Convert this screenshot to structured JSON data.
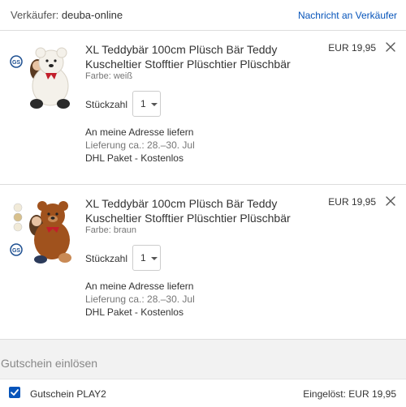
{
  "seller": {
    "label": "Verkäufer:",
    "name": "deuba-online",
    "contact_link": "Nachricht an Verkäufer"
  },
  "items": [
    {
      "title": "XL Teddybär 100cm Plüsch Bär Teddy Kuscheltier Stofftier Plüschtier Plüschbär",
      "variant": "Farbe: weiß",
      "price": "EUR 19,95",
      "qty_label": "Stückzahl",
      "qty_value": "1",
      "ship_method": "An meine Adresse liefern",
      "ship_date": "Lieferung ca.: 28.–30. Jul",
      "ship_carrier": "DHL Paket - Kostenlos",
      "image_icon": "white-teddy-bear-image",
      "bear_color": "#f4f1ea"
    },
    {
      "title": "XL Teddybär 100cm Plüsch Bär Teddy Kuscheltier Stofftier Plüschtier Plüschbär",
      "variant": "Farbe: braun",
      "price": "EUR 19,95",
      "qty_label": "Stückzahl",
      "qty_value": "1",
      "ship_method": "An meine Adresse liefern",
      "ship_date": "Lieferung ca.: 28.–30. Jul",
      "ship_carrier": "DHL Paket - Kostenlos",
      "image_icon": "brown-teddy-bear-image",
      "bear_color": "#a0521d"
    }
  ],
  "coupon": {
    "title": "Gutschein einlösen",
    "code": "Gutschein PLAY2",
    "redeemed_label": "Eingelöst:",
    "redeemed_value": "EUR 19,95"
  },
  "colors": {
    "link": "#0654ba",
    "checkbox": "#0654ba",
    "coupon_background": "#f2f2f2"
  }
}
